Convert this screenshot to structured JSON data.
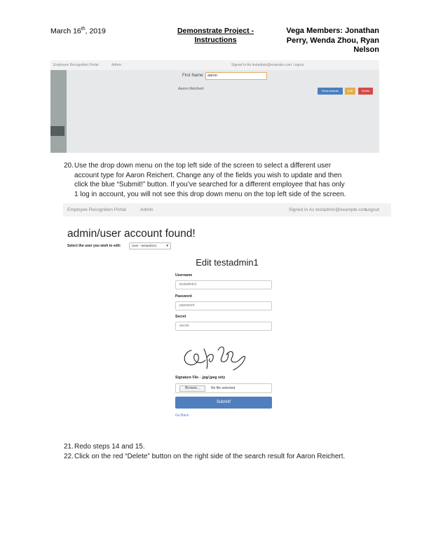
{
  "header": {
    "date_main": "March 16",
    "date_sup": "th",
    "date_year": ", 2019",
    "title_line1": "Demonstrate Project -",
    "title_line2": "Instructions",
    "members_line1": "Vega Members: Jonathan",
    "members_line2": "Perry, Wenda Zhou, Ryan",
    "members_line3": "Nelson"
  },
  "screenshot1": {
    "nav": {
      "brand": "Employee Recognition Portal",
      "admin": "Admin",
      "signed_in": "Signed In As testadmin@example.com",
      "logout": "Logout"
    },
    "first_name_label": "First Name:",
    "first_name_value": "aaron",
    "result_name": "Aaron Reichert",
    "buttons": {
      "show_awards": "Show Awards",
      "edit": "Edit",
      "delete": "Delete"
    },
    "colors": {
      "show_awards": "#4a7fbf",
      "edit": "#e6ad45",
      "delete": "#d24a48"
    }
  },
  "steps": {
    "step20": {
      "number": "20.",
      "line1": "Use the drop down menu on the top left side of the screen to select a different user",
      "line2": "account type for Aaron Reichert. Change any of the fields you wish to update and then",
      "line3": "click the blue “Submit!” button. If you’ve searched for a different employee that has only",
      "line4": "1 log in account, you will not see this drop down menu on the top left side of the screen."
    },
    "step21": {
      "number": "21.",
      "text": "Redo steps 14 and 15."
    },
    "step22": {
      "number": "22.",
      "text": "Click on the red “Delete” button on the right side of the search result for Aaron Reichert."
    }
  },
  "screenshot2": {
    "nav": {
      "brand": "Employee Recognition Portal",
      "admin": "Admin",
      "signed_in": "Signed In As testadmin@example.com",
      "logout": "Logout"
    },
    "found_heading": "admin/user account found!",
    "select_label": "Select the user you wish to edit:",
    "select_value": "User - testadmin1",
    "edit_title": "Edit testadmin1",
    "username_label": "Username",
    "username_value": "testadmin1",
    "password_label": "Password",
    "password_value": "password",
    "secret_label": "Secret",
    "secret_value": "secret",
    "signature_file_label": "Signature File - .jpg/.jpeg only",
    "browse_label": "Browse...",
    "no_file_label": "No file selected.",
    "submit_label": "Submit!",
    "go_back_label": "Go Back",
    "submit_color": "#4f7fbc"
  }
}
